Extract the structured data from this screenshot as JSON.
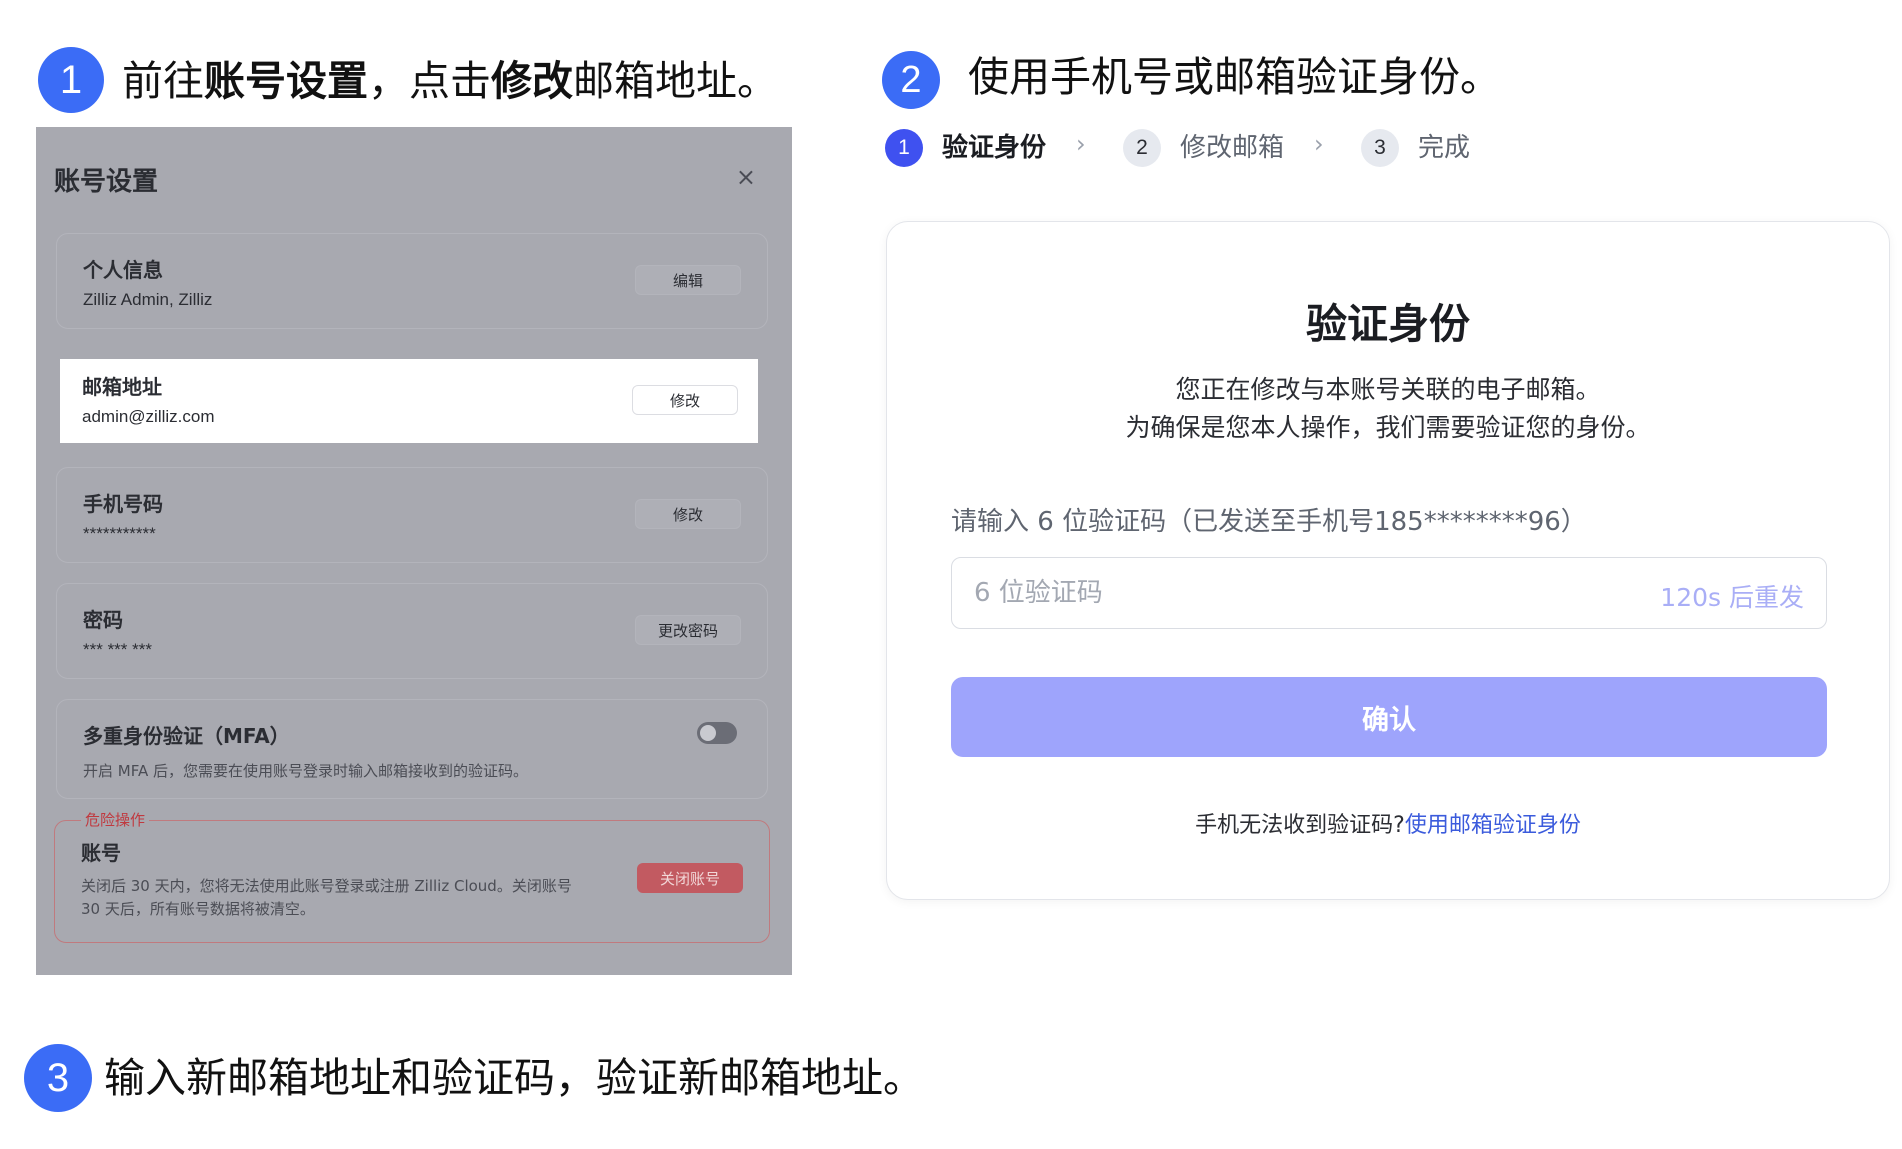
{
  "steps": [
    {
      "number": "1",
      "title_pre": "前往",
      "title_bold1": "账号设置",
      "title_mid": "，点击",
      "title_bold2": "修改",
      "title_post": "邮箱地址。"
    },
    {
      "number": "2",
      "title": "使用手机号或邮箱验证身份。"
    },
    {
      "number": "3",
      "title": "输入新邮箱地址和验证码，验证新邮箱地址。"
    }
  ],
  "account_settings": {
    "title": "账号设置",
    "close_icon": "×",
    "profile": {
      "label": "个人信息",
      "value": "Zilliz Admin, Zilliz",
      "button": "编辑"
    },
    "email": {
      "label": "邮箱地址",
      "value": "admin@zilliz.com",
      "button": "修改"
    },
    "phone": {
      "label": "手机号码",
      "value": "***********",
      "button": "修改"
    },
    "password": {
      "label": "密码",
      "value": "*** *** ***",
      "button": "更改密码"
    },
    "mfa": {
      "label": "多重身份验证（MFA）",
      "description": "开启 MFA 后，您需要在使用账号登录时输入邮箱接收到的验证码。",
      "enabled": false
    },
    "danger": {
      "section_label": "危险操作",
      "label": "账号",
      "description_line1": "关闭后 30 天内，您将无法使用此账号登录或注册 Zilliz Cloud。关闭账号",
      "description_line2": "30 天后，所有账号数据将被清空。",
      "button": "关闭账号"
    }
  },
  "stepper": [
    {
      "num": "1",
      "label": "验证身份",
      "active": true
    },
    {
      "num": "2",
      "label": "修改邮箱",
      "active": false
    },
    {
      "num": "3",
      "label": "完成",
      "active": false
    }
  ],
  "stepper_chevron": "›",
  "verify": {
    "title": "验证身份",
    "desc_line1": "您正在修改与本账号关联的电子邮箱。",
    "desc_line2": "为确保是您本人操作，我们需要验证您的身份。",
    "prompt": "请输入 6 位验证码（已发送至手机号185********96）",
    "input_placeholder": "6 位验证码",
    "resend": "120s 后重发",
    "confirm": "确认",
    "help_text": "手机无法收到验证码?",
    "help_link": "使用邮箱验证身份"
  },
  "colors": {
    "badge": "#3b6cf6",
    "confirm_button": "#9ea4fc",
    "link": "#3b5bdc",
    "danger": "#c25a61"
  }
}
